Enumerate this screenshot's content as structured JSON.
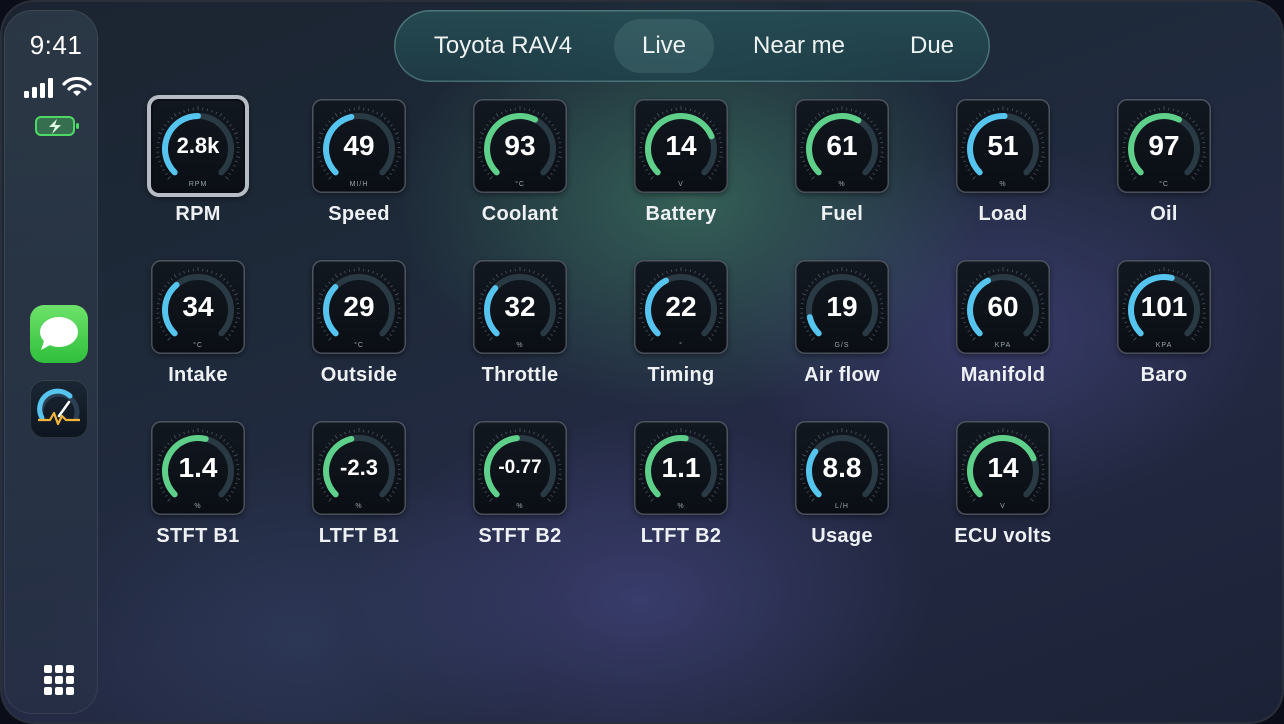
{
  "status": {
    "time": "9:41"
  },
  "tabs": [
    {
      "label": "Toyota RAV4",
      "active": false
    },
    {
      "label": "Live",
      "active": true
    },
    {
      "label": "Near me",
      "active": false
    },
    {
      "label": "Due",
      "active": false
    }
  ],
  "colors": {
    "blue": "#55c4ee",
    "green": "#5fd08a",
    "track": "#2a3a44"
  },
  "gauges": [
    {
      "value": "2.8k",
      "unit": "RPM",
      "label": "RPM",
      "level": 0.5,
      "color": "blue",
      "selected": true
    },
    {
      "value": "49",
      "unit": "MI/H",
      "label": "Speed",
      "level": 0.45,
      "color": "blue"
    },
    {
      "value": "93",
      "unit": "°C",
      "label": "Coolant",
      "level": 0.6,
      "color": "green"
    },
    {
      "value": "14",
      "unit": "V",
      "label": "Battery",
      "level": 0.75,
      "color": "green"
    },
    {
      "value": "61",
      "unit": "%",
      "label": "Fuel",
      "level": 0.61,
      "color": "green"
    },
    {
      "value": "51",
      "unit": "%",
      "label": "Load",
      "level": 0.51,
      "color": "blue"
    },
    {
      "value": "97",
      "unit": "°C",
      "label": "Oil",
      "level": 0.6,
      "color": "green"
    },
    {
      "value": "34",
      "unit": "°C",
      "label": "Intake",
      "level": 0.35,
      "color": "blue"
    },
    {
      "value": "29",
      "unit": "°C",
      "label": "Outside",
      "level": 0.33,
      "color": "blue"
    },
    {
      "value": "32",
      "unit": "%",
      "label": "Throttle",
      "level": 0.32,
      "color": "blue"
    },
    {
      "value": "22",
      "unit": "°",
      "label": "Timing",
      "level": 0.4,
      "color": "blue"
    },
    {
      "value": "19",
      "unit": "G/S",
      "label": "Air flow",
      "level": 0.12,
      "color": "blue"
    },
    {
      "value": "60",
      "unit": "KPA",
      "label": "Manifold",
      "level": 0.4,
      "color": "blue"
    },
    {
      "value": "101",
      "unit": "KPA",
      "label": "Baro",
      "level": 0.55,
      "color": "blue"
    },
    {
      "value": "1.4",
      "unit": "%",
      "label": "STFT B1",
      "level": 0.55,
      "color": "green"
    },
    {
      "value": "-2.3",
      "unit": "%",
      "label": "LTFT B1",
      "level": 0.45,
      "color": "green"
    },
    {
      "value": "-0.77",
      "unit": "%",
      "label": "STFT B2",
      "level": 0.48,
      "color": "green"
    },
    {
      "value": "1.1",
      "unit": "%",
      "label": "LTFT B2",
      "level": 0.53,
      "color": "green"
    },
    {
      "value": "8.8",
      "unit": "L/H",
      "label": "Usage",
      "level": 0.3,
      "color": "blue"
    },
    {
      "value": "14",
      "unit": "V",
      "label": "ECU volts",
      "level": 0.75,
      "color": "green"
    }
  ]
}
